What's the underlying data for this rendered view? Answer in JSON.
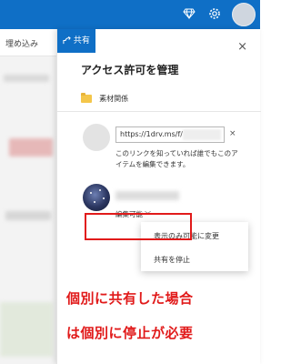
{
  "topbar": {
    "icons": [
      "diamond-icon",
      "gear-icon",
      "help-icon"
    ],
    "help_label": "?"
  },
  "background": {
    "command_text": "埋め込み"
  },
  "panel": {
    "share_tab_label": "共有",
    "close_label": "×",
    "title": "アクセス許可を管理",
    "folder_name": "素材関係",
    "link": {
      "url": "https://1drv.ms/f/",
      "remove_label": "×",
      "description": "このリンクを知っていれば誰でもこのアイテムを編集できます。"
    },
    "user": {
      "permission_label": "編集可能",
      "chevron": "﹀"
    },
    "menu": {
      "items": [
        "表示のみ可能に変更",
        "共有を停止"
      ]
    }
  },
  "annotation": {
    "line1": "個別に共有した場合",
    "line2": "は個別に停止が必要",
    "color": "#e11a1a"
  },
  "colors": {
    "brand_blue": "#0f6fc6",
    "folder_yellow": "#f4c64a"
  }
}
